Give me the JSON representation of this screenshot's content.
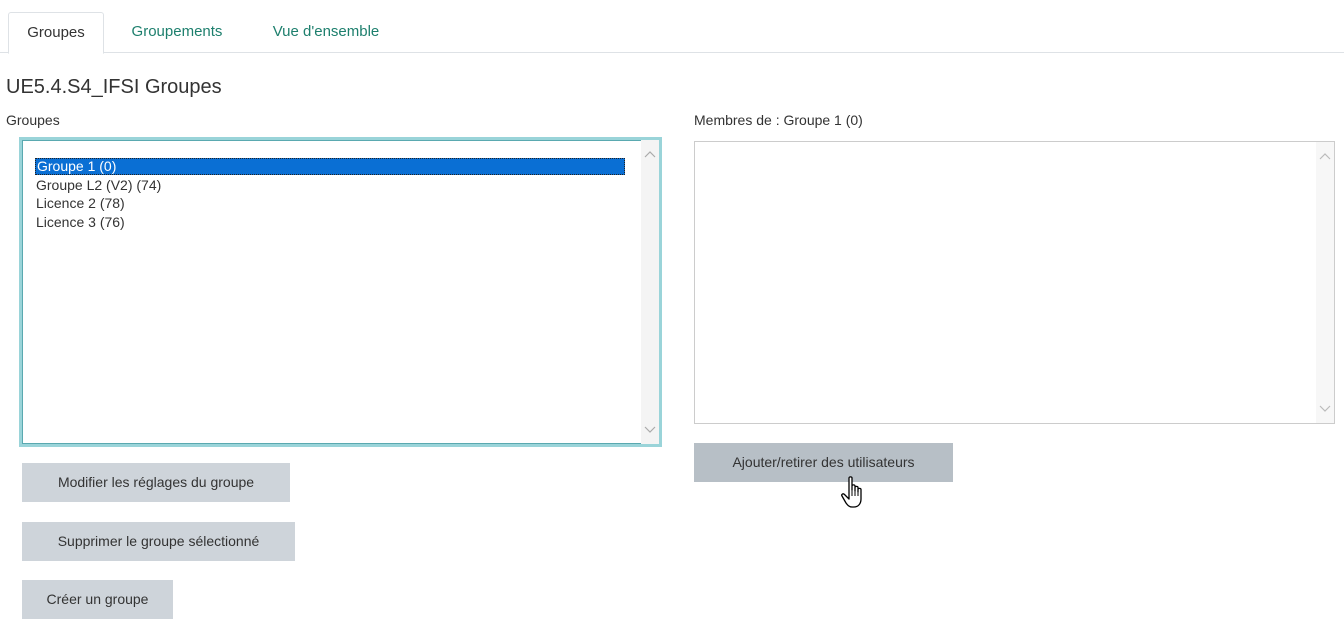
{
  "tabs": [
    {
      "label": "Groupes",
      "active": true
    },
    {
      "label": "Groupements",
      "active": false
    },
    {
      "label": "Vue d'ensemble",
      "active": false
    }
  ],
  "page_title": "UE5.4.S4_IFSI Groupes",
  "groups_panel": {
    "label": "Groupes",
    "options": [
      {
        "label": "Groupe 1 (0)",
        "selected": true
      },
      {
        "label": "Groupe L2 (V2) (74)",
        "selected": false
      },
      {
        "label": "Licence 2 (78)",
        "selected": false
      },
      {
        "label": "Licence 3 (76)",
        "selected": false
      }
    ]
  },
  "members_panel": {
    "label": "Membres de : Groupe 1 (0)",
    "options": []
  },
  "buttons": {
    "edit_group": "Modifier les réglages du groupe",
    "delete_group": "Supprimer le groupe sélectionné",
    "create_group": "Créer un groupe",
    "add_remove_users": "Ajouter/retirer des utilisateurs"
  },
  "icons": {
    "scroll_up": "chevron-up-icon",
    "scroll_down": "chevron-down-icon",
    "cursor": "hand-pointer-icon"
  },
  "colors": {
    "link": "#1d7f6d",
    "selection": "#0a6fd4",
    "button": "#ced4da",
    "focus_border": "#9ad4d9"
  }
}
